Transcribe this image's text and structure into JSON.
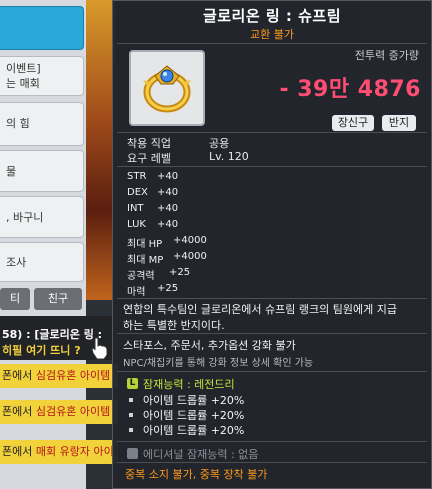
{
  "sidebar": {
    "items": [
      {
        "label": "",
        "active": true
      },
      {
        "label": "이벤트]\n는 매회"
      },
      {
        "label": "의 힘"
      },
      {
        "label": "물"
      },
      {
        "label": ", 바구니"
      },
      {
        "label": "조사"
      }
    ],
    "buttons": [
      "티",
      "친구"
    ]
  },
  "chat": {
    "speaker": "58) : [글로리온 링 :",
    "message": "히필 여기 뜨니 ?",
    "lines": [
      {
        "prefix": "폰에서 ",
        "highlight": "심검유혼 아이템"
      },
      {
        "prefix": "폰에서 ",
        "highlight": "심검유혼 아이템"
      },
      {
        "prefix": "폰에서 ",
        "highlight": "매회 유랑자 아이템"
      }
    ]
  },
  "tooltip": {
    "title": "글로리온 링 : 슈프림",
    "subtitle": "교환 불가",
    "icon": "glorion-ring-icon",
    "combat_power_label": "전투력 증가량",
    "combat_power_value": "- 39만 4876",
    "chips": [
      "장신구",
      "반지"
    ],
    "requirements": [
      {
        "label": "착용 직업",
        "value": "공용"
      },
      {
        "label": "요구 레벨",
        "value": "Lv. 120"
      }
    ],
    "stats": [
      {
        "label": "STR",
        "value": "+40"
      },
      {
        "label": "DEX",
        "value": "+40"
      },
      {
        "label": "INT",
        "value": "+40"
      },
      {
        "label": "LUK",
        "value": "+40"
      },
      {
        "label": "최대 HP",
        "value": "+4000"
      },
      {
        "label": "최대 MP",
        "value": "+4000"
      },
      {
        "label": "공격력",
        "value": "+25"
      },
      {
        "label": "마력",
        "value": "+25"
      }
    ],
    "description": [
      "연합의 특수팀인 글로리온에서 슈프림 랭크의 팀원에게 지급",
      "하는 특별한 반지이다."
    ],
    "notes": [
      "스타포스, 주문서, 추가옵션 강화 불가",
      "NPC/채집키를 통해 강화 정보 상세 확인 가능"
    ],
    "potential": {
      "badge": "L",
      "header": "잠재능력 : 레전드리",
      "lines": [
        "아이템 드롭률 +20%",
        "아이템 드롭률 +20%",
        "아이템 드롭률 +20%"
      ]
    },
    "additional": "에디셔널 잠재능력 : 없음",
    "warning": "중복 소지 불가, 중복 장착 불가"
  },
  "colors": {
    "title": "#ffffff",
    "orange": "#ff9a1e",
    "combat_power": "#ff4d73",
    "legendary": "#c5e63b"
  }
}
